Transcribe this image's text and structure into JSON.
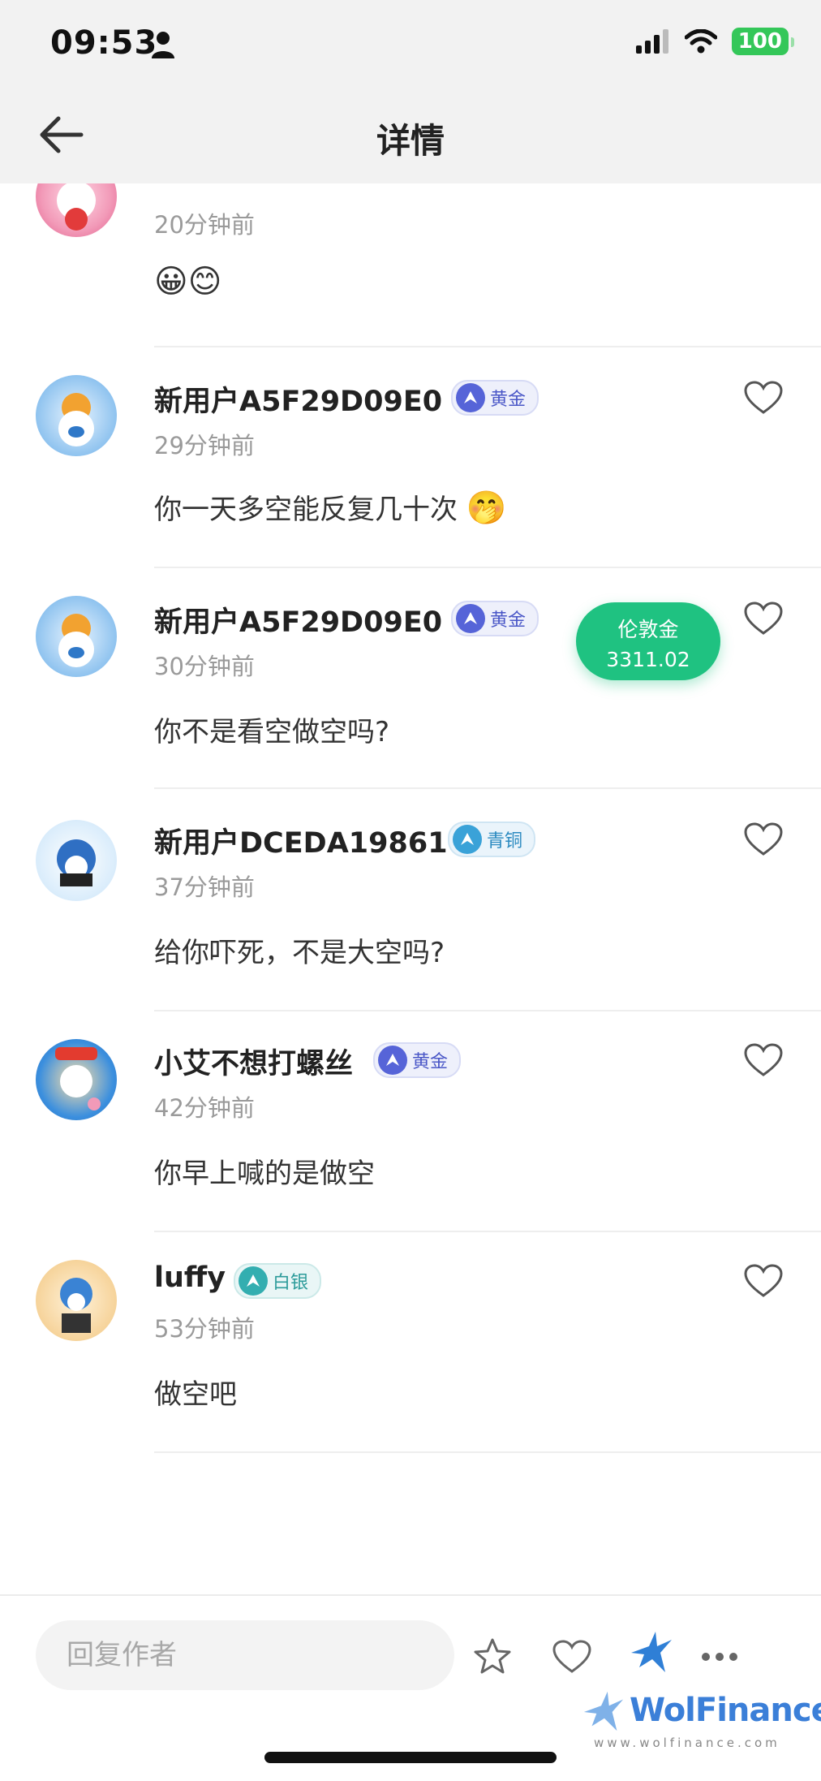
{
  "status_bar": {
    "time": "09:53",
    "battery": "100"
  },
  "header": {
    "title": "详情"
  },
  "partial_comment": {
    "time": "20分钟前",
    "text": "😀😊"
  },
  "comments": [
    {
      "name": "新用户A5F29D09E0",
      "badge": "黄金",
      "time": "29分钟前",
      "text": "你一天多空能反复几十次",
      "emoji": "🤭"
    },
    {
      "name": "新用户A5F29D09E0",
      "badge": "黄金",
      "time": "30分钟前",
      "text": "你不是看空做空吗?"
    },
    {
      "name": "新用户DCEDA19861",
      "badge": "青铜",
      "time": "37分钟前",
      "text": "给你吓死，不是大空吗?"
    },
    {
      "name": "小艾不想打螺丝",
      "badge": "黄金",
      "time": "42分钟前",
      "text": "你早上喊的是做空"
    },
    {
      "name": "luffy",
      "badge": "白银",
      "time": "53分钟前",
      "text": "做空吧"
    }
  ],
  "float_price": {
    "name": "伦敦金",
    "value": "3311.02"
  },
  "bottom_bar": {
    "reply_placeholder": "回复作者"
  },
  "watermark": {
    "brand": "WolFinance",
    "url": "www.wolfinance.com"
  },
  "colors": {
    "accent_green": "#1fc281",
    "gold_badge": "#5664d8",
    "bronze_badge": "#3aa2d8",
    "silver_badge": "#33aeb0",
    "brand_blue": "#2f7fd6"
  },
  "icons": [
    "person-icon",
    "signal-icon",
    "wifi-icon",
    "back-arrow-icon",
    "heart-icon",
    "star-icon",
    "wolf-logo-icon",
    "more-icon"
  ]
}
